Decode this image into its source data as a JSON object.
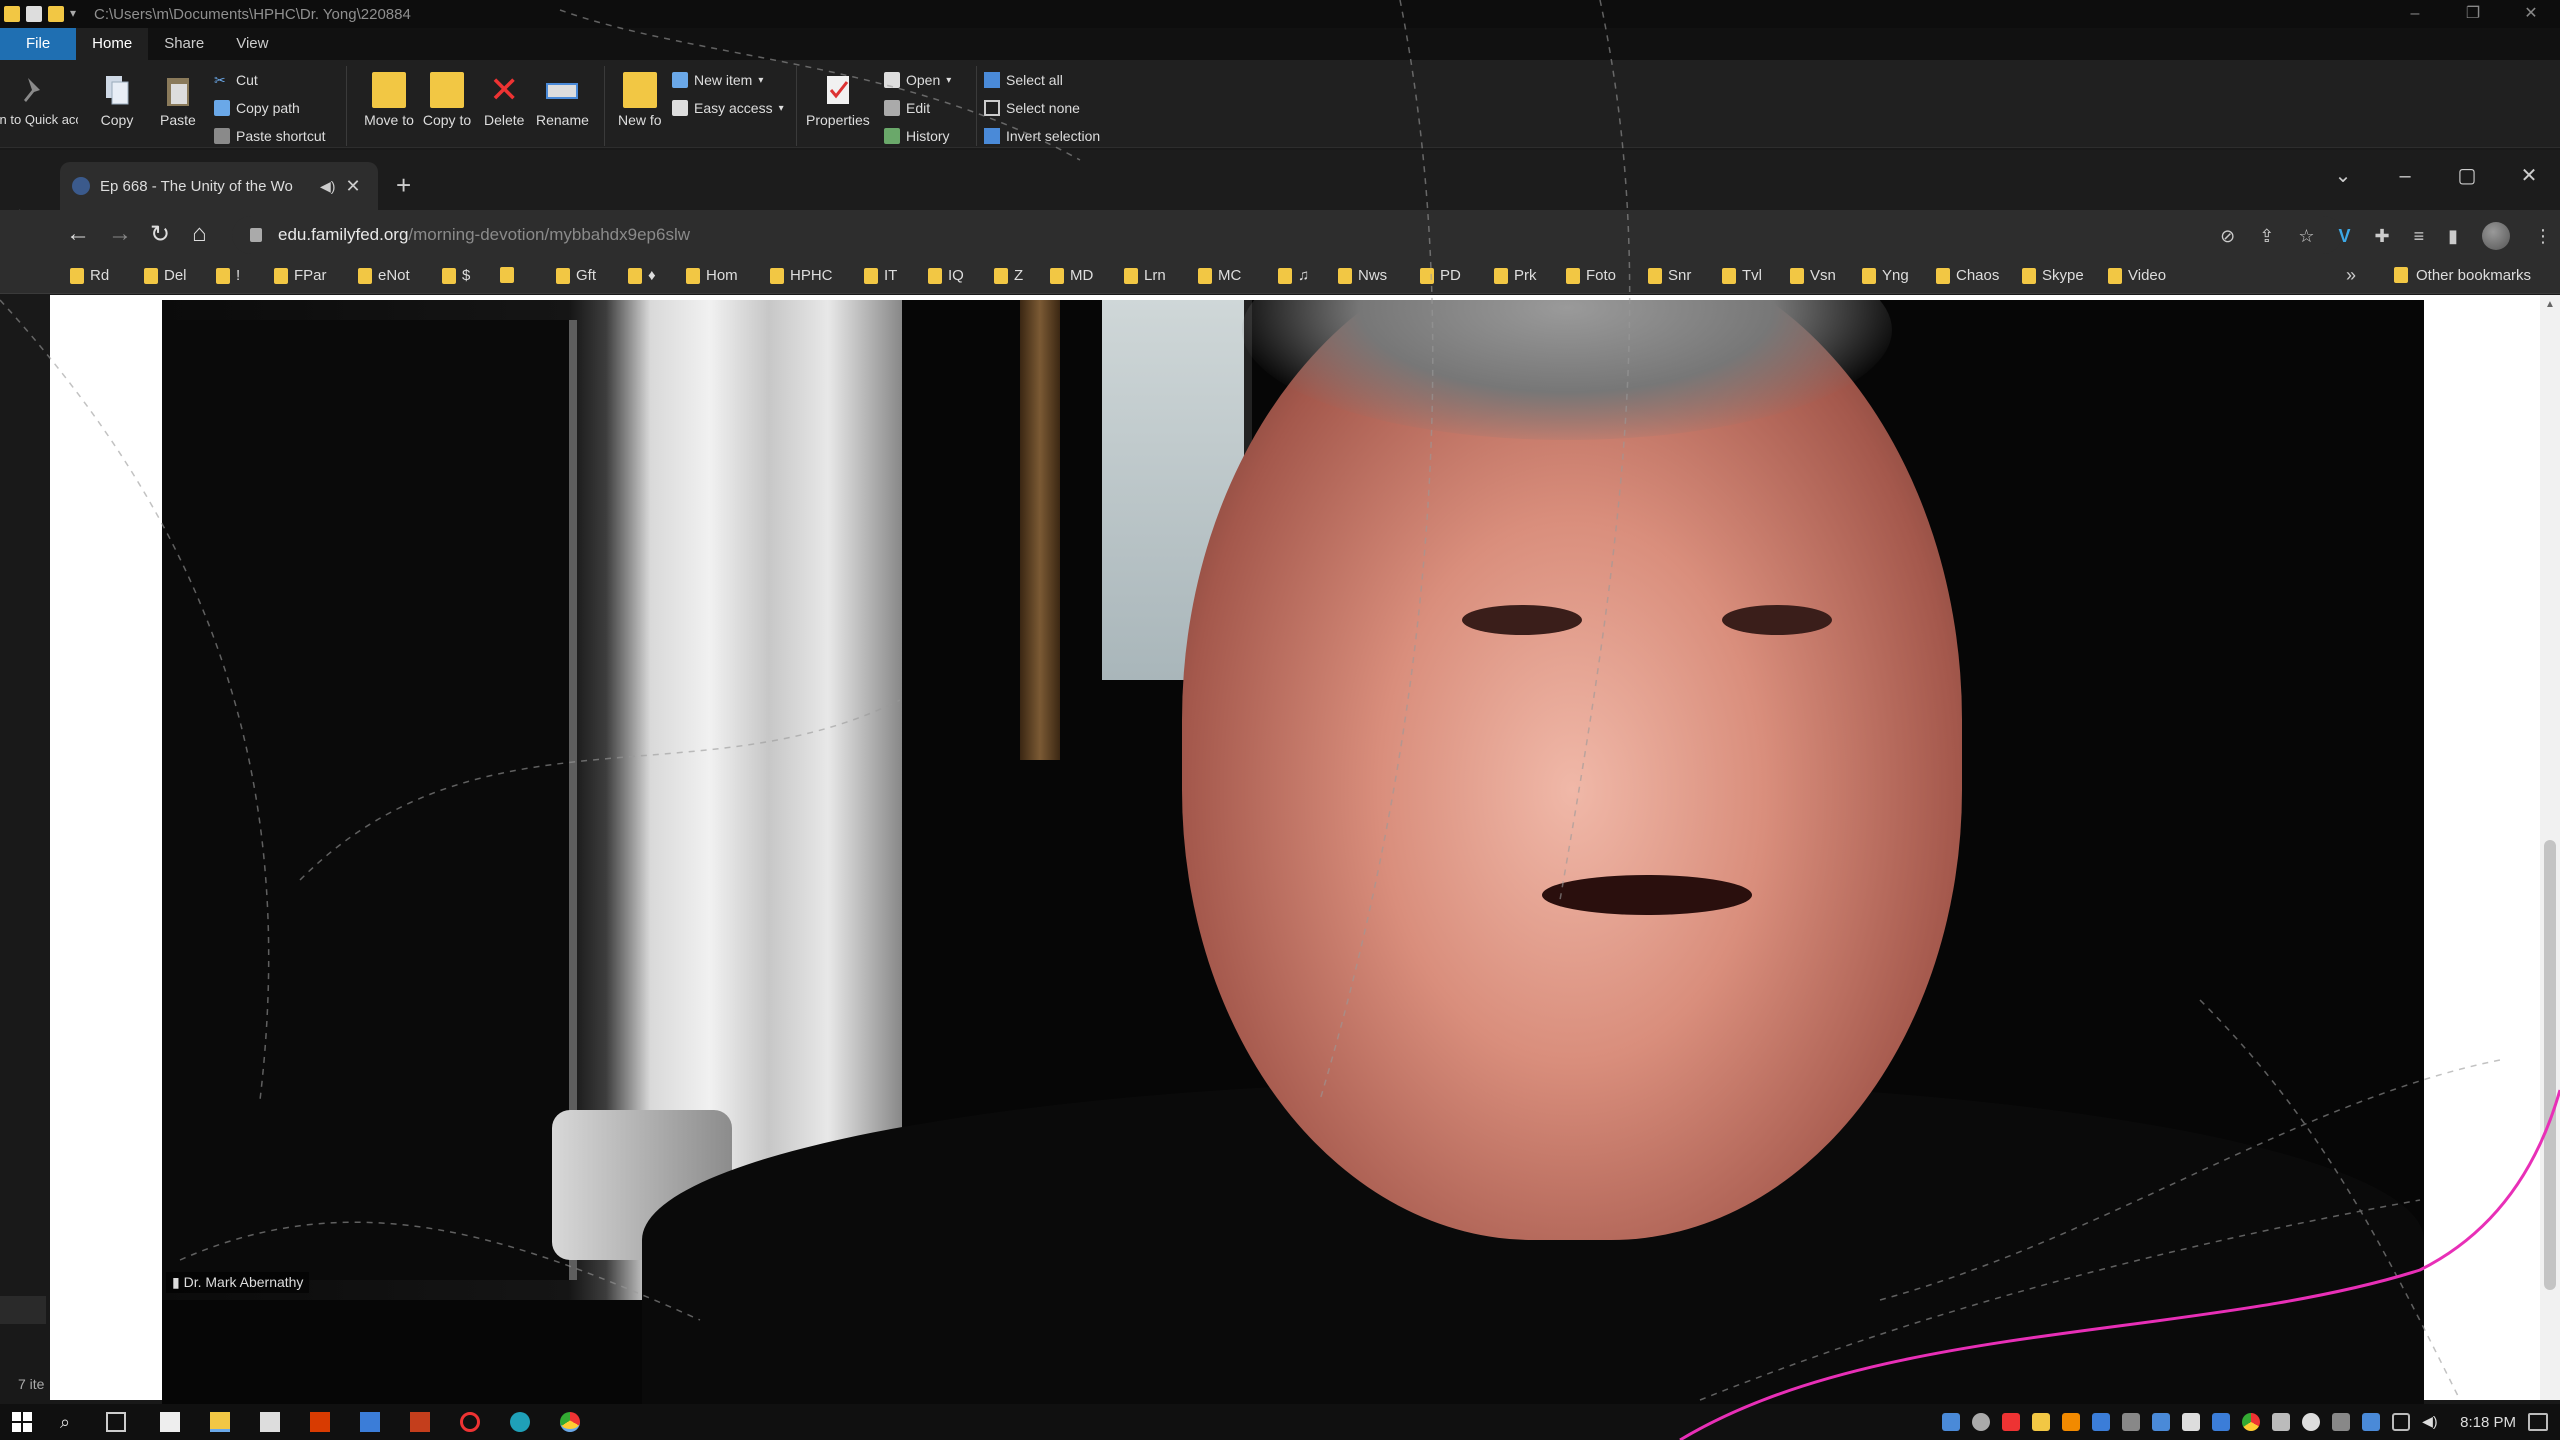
{
  "explorer": {
    "path": "C:\\Users\\m\\Documents\\HPHC\\Dr. Yong\\220884",
    "tabs": [
      "File",
      "Home",
      "Share",
      "View"
    ],
    "ribbon": {
      "pin": "Pin to Quick access",
      "copy": "Copy",
      "paste": "Paste",
      "cut": "Cut",
      "copy_path": "Copy path",
      "paste_shortcut": "Paste shortcut",
      "move_to": "Move to",
      "copy_to": "Copy to",
      "delete": "Delete",
      "rename": "Rename",
      "new_folder": "New folder",
      "new_item": "New item",
      "easy_access": "Easy access",
      "properties": "Properties",
      "open": "Open",
      "edit": "Edit",
      "history": "History",
      "select_all": "Select all",
      "select_none": "Select none",
      "invert_selection": "Invert selection"
    },
    "status": "7 ite"
  },
  "chrome": {
    "tab_title": "Ep 668 - The Unity of the Wo",
    "url_host": "edu.familyfed.org",
    "url_path": "/morning-devotion/mybbahdx9ep6slw",
    "bookmarks": [
      "Rd",
      "Del",
      "!",
      "FPar",
      "eNot",
      "$",
      "",
      "Gft",
      "♦",
      "Hom",
      "HPHC",
      "IT",
      "IQ",
      "Z",
      "MD",
      "Lrn",
      "MC",
      "♫",
      "Nws",
      "PD",
      "Prk",
      "Foto",
      "Snr",
      "Tvl",
      "Vsn",
      "Yng",
      "Chaos",
      "Skype",
      "Video"
    ],
    "other_bookmarks": "Other bookmarks"
  },
  "video": {
    "participant": "Dr. Mark Abernathy"
  },
  "taskbar": {
    "clock": "8:18 PM"
  },
  "colors": {
    "accent": "#1f6fb2",
    "folder": "#f2c744",
    "overlay_line": "#e82fb7"
  }
}
